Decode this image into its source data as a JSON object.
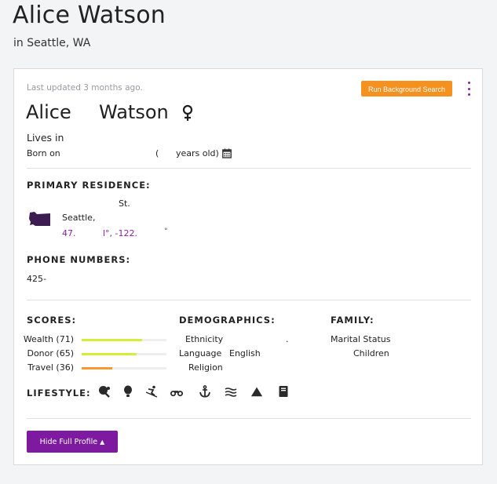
{
  "header": {
    "title": "Alice Watson",
    "subtitle": "in Seattle, WA"
  },
  "card": {
    "last_updated": "Last updated 3 months ago.",
    "background_search_label": "Run Background Search",
    "first_name": "Alice",
    "last_name": "Watson",
    "lives_in": "Lives in",
    "born_label": "Born on",
    "born_paren": "(",
    "born_years": "years old)"
  },
  "residence": {
    "heading": "PRIMARY RESIDENCE:",
    "street": "St.",
    "city": "Seattle,",
    "coord_lat": "47.",
    "coord_lon": "l°, -122.",
    "coord_deg": "°"
  },
  "phones": {
    "heading": "PHONE NUMBERS:",
    "value": "425-"
  },
  "scores": {
    "heading": "SCORES:",
    "items": [
      {
        "label": "Wealth (71)",
        "value": 71,
        "color": "#d4ef3a"
      },
      {
        "label": "Donor (65)",
        "value": 65,
        "color": "#d4ef3a"
      },
      {
        "label": "Travel (36)",
        "value": 36,
        "color": "#f79a2e"
      }
    ]
  },
  "demographics": {
    "heading": "DEMOGRAPHICS:",
    "ethnicity_label": "Ethnicity",
    "ethnicity_value": ".",
    "language_label": "Language",
    "language_value": "English",
    "religion_label": "Religion"
  },
  "family": {
    "heading": "FAMILY:",
    "marital_label": "Marital Status",
    "children_label": "Children"
  },
  "lifestyle": {
    "heading": "LIFESTYLE:",
    "icons": [
      "ping-pong-icon",
      "hot-air-balloon-icon",
      "skiing-icon",
      "motorcycle-icon",
      "anchor-icon",
      "water-icon",
      "mountain-icon",
      "book-icon"
    ]
  },
  "footer": {
    "hide_profile_label": "Hide Full Profile",
    "hide_profile_chevron": "▲"
  },
  "colors": {
    "accent_purple": "#7d1aa0",
    "accent_orange": "#f5911e"
  }
}
